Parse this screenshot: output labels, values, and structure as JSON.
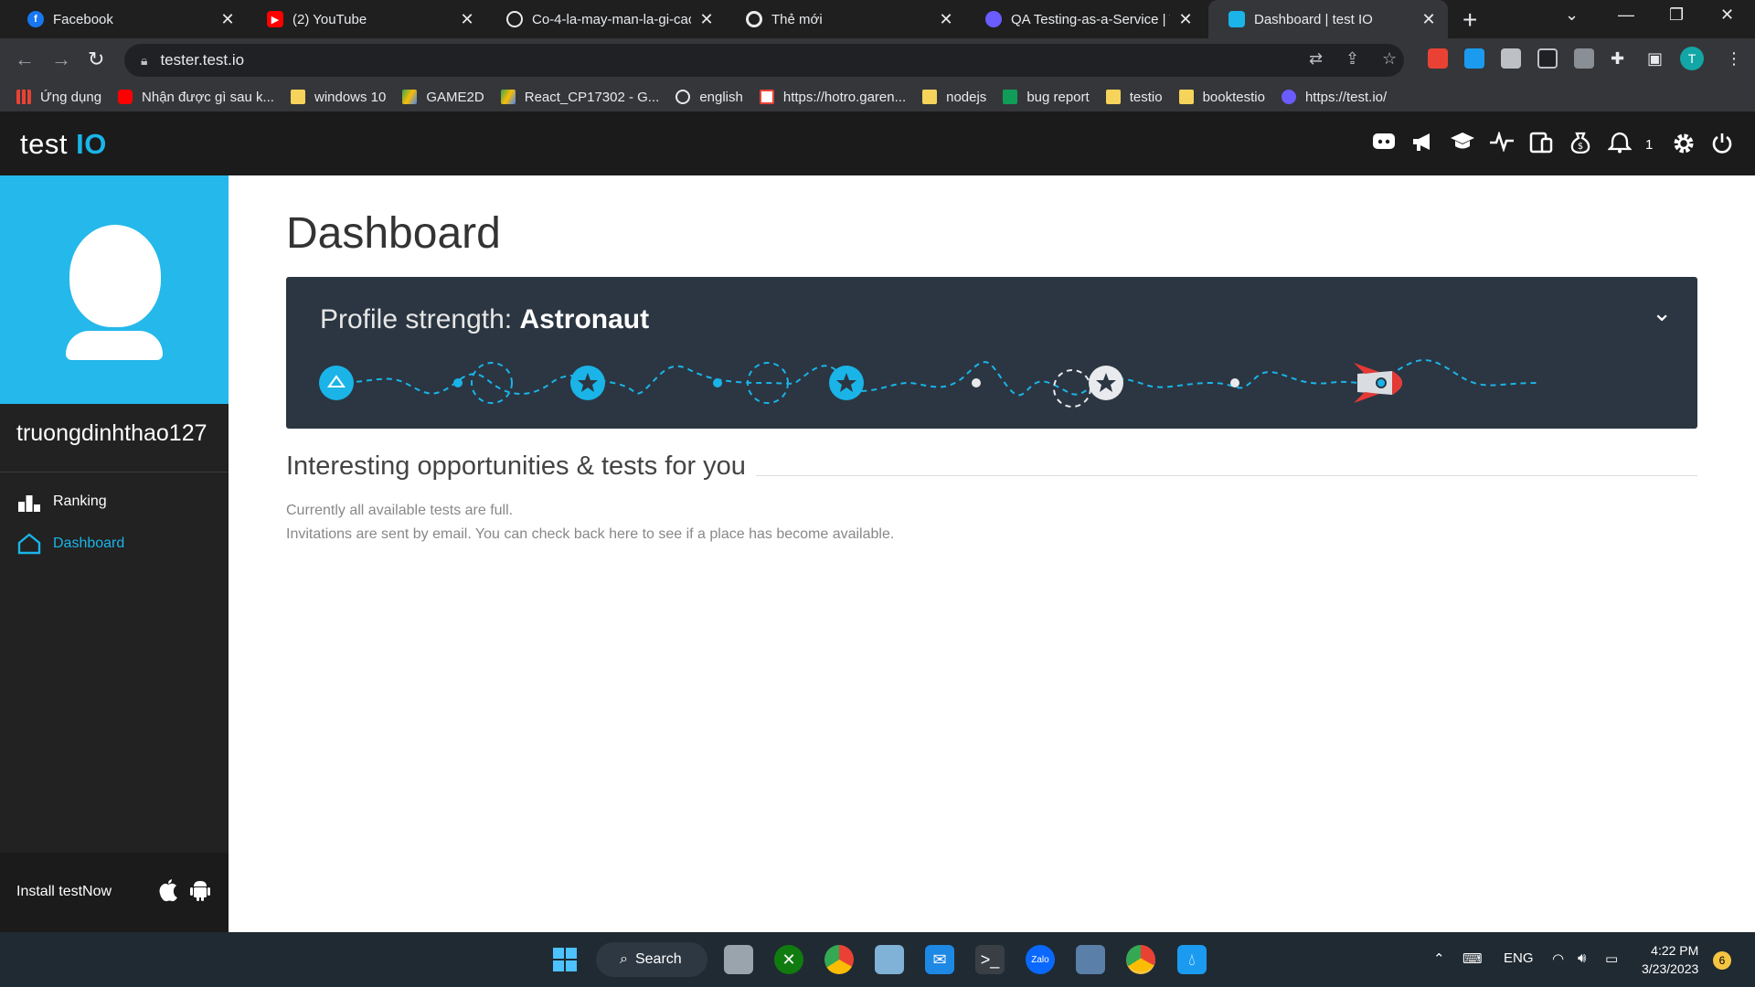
{
  "browser": {
    "tabs": [
      {
        "title": "Facebook",
        "icon": "facebook-icon",
        "color": "#1877f2",
        "glyph": "f"
      },
      {
        "title": "(2) YouTube",
        "icon": "youtube-icon",
        "color": "#ff0000",
        "glyph": "▶"
      },
      {
        "title": "Co-4-la-may-man-la-gi-cac",
        "icon": "globe-icon",
        "color": "#5f6368",
        "glyph": "◎"
      },
      {
        "title": "Thẻ mới",
        "icon": "chrome-icon",
        "color": "#5f6368",
        "glyph": "◉"
      },
      {
        "title": "QA Testing-as-a-Service | Te",
        "icon": "testio-tab-icon",
        "color": "#6a5cff",
        "glyph": "◌"
      },
      {
        "title": "Dashboard | test IO",
        "icon": "testio-tab-icon",
        "color": "#1ab4e8",
        "glyph": "◌"
      }
    ],
    "url": "tester.test.io",
    "bookmarks": [
      {
        "label": "Ứng dụng",
        "icon": "apps-grid-icon",
        "color": "#e94235"
      },
      {
        "label": "Nhận được gì sau k...",
        "icon": "youtube-icon",
        "color": "#ff0000"
      },
      {
        "label": "windows 10",
        "icon": "folder-icon",
        "color": "#f6d35a"
      },
      {
        "label": "GAME2D",
        "icon": "google-drive-icon",
        "color": "#34a853"
      },
      {
        "label": "React_CP17302 - G...",
        "icon": "google-drive-icon",
        "color": "#4285f4"
      },
      {
        "label": "english",
        "icon": "globe-icon",
        "color": "#e8eaed"
      },
      {
        "label": "https://hotro.garen...",
        "icon": "garena-icon",
        "color": "#e94235"
      },
      {
        "label": "nodejs",
        "icon": "folder-icon",
        "color": "#f6d35a"
      },
      {
        "label": "bug report",
        "icon": "google-sheets-icon",
        "color": "#0f9d58"
      },
      {
        "label": "testio",
        "icon": "folder-icon",
        "color": "#f6d35a"
      },
      {
        "label": "booktestio",
        "icon": "folder-icon",
        "color": "#f6d35a"
      },
      {
        "label": "https://test.io/",
        "icon": "testio-icon",
        "color": "#6a5cff"
      }
    ],
    "profile_initial": "T"
  },
  "app": {
    "logo_text": "test",
    "logo_io": "IO",
    "notification_count": "1",
    "header_icons": [
      "discord-icon",
      "megaphone-icon",
      "graduation-cap-icon",
      "activity-icon",
      "devices-icon",
      "money-bag-icon",
      "bell-icon",
      "gear-icon",
      "power-icon"
    ]
  },
  "sidebar": {
    "username": "truongdinhthao127",
    "items": [
      {
        "label": "Ranking",
        "icon": "ranking-icon",
        "active": false
      },
      {
        "label": "Dashboard",
        "icon": "home-icon",
        "active": true
      }
    ],
    "install_label": "Install testNow"
  },
  "main": {
    "title": "Dashboard",
    "profile_strength_label": "Profile strength:",
    "profile_strength_value": "Astronaut",
    "opportunities_title": "Interesting opportunities & tests for you",
    "message_line1": "Currently all available tests are full.",
    "message_line2": "Invitations are sent by email. You can check back here to see if a place has become available."
  },
  "taskbar": {
    "search_label": "Search",
    "language": "ENG",
    "time": "4:22 PM",
    "date": "3/23/2023",
    "notification_badge": "6"
  },
  "colors": {
    "accent": "#1ab4e8",
    "card": "#2b3642",
    "header": "#1b1b1b",
    "sidebar": "#222222"
  }
}
